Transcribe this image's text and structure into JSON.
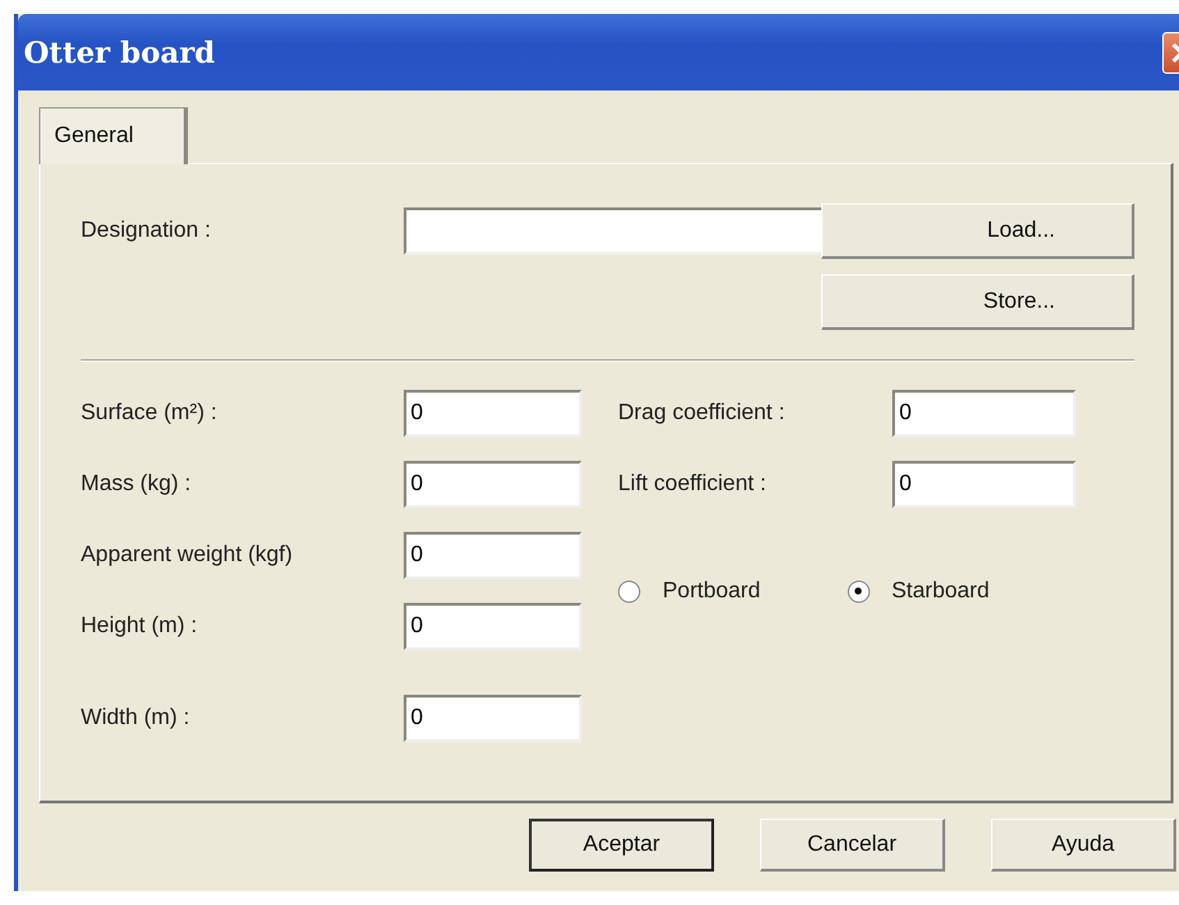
{
  "window": {
    "title": "Otter board"
  },
  "tabs": [
    {
      "label": "General",
      "selected": true
    }
  ],
  "designation": {
    "label": "Designation :"
  },
  "side_buttons": [
    "Load...",
    "Store..."
  ],
  "left_fields": [
    {
      "label": "Surface (m²) :",
      "value": "0"
    },
    {
      "label": "Mass (kg) :",
      "value": "0"
    },
    {
      "label": "Apparent weight (kgf)",
      "value": "0"
    },
    {
      "label": "Height (m) :",
      "value": "0"
    },
    {
      "label": "Width (m) :",
      "value": "0"
    }
  ],
  "right_fields": [
    {
      "label": "Drag coefficient :",
      "value": "0"
    },
    {
      "label": "Lift coefficient :",
      "value": "0"
    }
  ],
  "radios": [
    {
      "label": "Portboard",
      "selected": false
    },
    {
      "label": "Starboard",
      "selected": true
    }
  ],
  "buttons": [
    {
      "label": "Aceptar",
      "default": true
    },
    {
      "label": "Cancelar",
      "default": false
    },
    {
      "label": "Ayuda",
      "default": false
    }
  ]
}
